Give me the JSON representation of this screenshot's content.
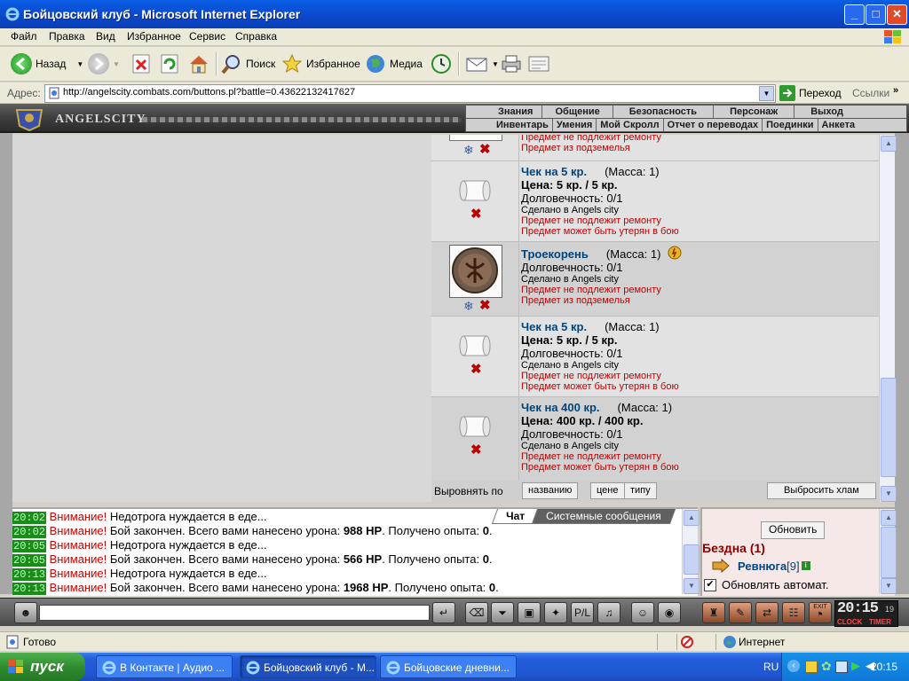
{
  "window": {
    "title": "Бойцовский клуб - Microsoft Internet Explorer",
    "buttons": {
      "minimize": "_",
      "maximize": "□",
      "close": "✕"
    }
  },
  "menu": [
    "Файл",
    "Правка",
    "Вид",
    "Избранное",
    "Сервис",
    "Справка"
  ],
  "toolbar": {
    "back": "Назад",
    "search": "Поиск",
    "favorites": "Избранное",
    "media": "Медиа"
  },
  "address": {
    "label": "Адрес:",
    "url": "http://angelscity.combats.com/buttons.pl?battle=0.43622132417627",
    "go": "Переход",
    "links": "Ссылки"
  },
  "game_header": {
    "logo_text": "ANGELSCITY",
    "nav_top": [
      "Знания",
      "Общение",
      "Безопасность",
      "Персонаж",
      "Выход"
    ],
    "nav_bottom": [
      "Инвентарь",
      "Умения",
      "Мой Скролл",
      "Отчет о переводах",
      "Поединки",
      "Анкета"
    ]
  },
  "items": [
    {
      "partial": true,
      "lines_red": [
        "Предмет не подлежит ремонту",
        "Предмет из подземелья"
      ]
    },
    {
      "name": "Чек на 5 кр.",
      "mass": "(Масса: 1)",
      "price": "Цена: 5 кр. / 5 кр.",
      "durability": "Долговечность: 0/1",
      "made": "Сделано в Angels city",
      "lines_red": [
        "Предмет не подлежит ремонту",
        "Предмет может быть утерян в бою"
      ]
    },
    {
      "name": "Троекорень",
      "mass": "(Масса: 1)",
      "durability": "Долговечность: 0/1",
      "made": "Сделано в Angels city",
      "lines_red": [
        "Предмет не подлежит ремонту",
        "Предмет из подземелья"
      ]
    },
    {
      "name": "Чек на 5 кр.",
      "mass": "(Масса: 1)",
      "price": "Цена: 5 кр. / 5 кр.",
      "durability": "Долговечность: 0/1",
      "made": "Сделано в Angels city",
      "lines_red": [
        "Предмет не подлежит ремонту",
        "Предмет может быть утерян в бою"
      ]
    },
    {
      "name": "Чек на 400 кр.",
      "mass": "(Масса: 1)",
      "price": "Цена: 400 кр. / 400 кр.",
      "durability": "Долговечность: 0/1",
      "made": "Сделано в Angels city",
      "lines_red": [
        "Предмет не подлежит ремонту",
        "Предмет может быть утерян в бою"
      ]
    }
  ],
  "sort": {
    "label": "Выровнять по",
    "by_name": "названию",
    "by_price": "цене",
    "by_type": "типу",
    "drop_junk": "Выбросить хлам"
  },
  "chat": {
    "tabs": [
      "Чат",
      "Системные сообщения"
    ],
    "lines": [
      {
        "time": "20:02",
        "warn": "Внимание!",
        "text": " Недотрога нуждается в еде..."
      },
      {
        "time": "20:02",
        "warn": "Внимание!",
        "text": " Бой закончен. Всего вами нанесено урона: ",
        "hp": "988 HP",
        "text2": ". Получено опыта: ",
        "exp": "0",
        "end": "."
      },
      {
        "time": "20:05",
        "warn": "Внимание!",
        "text": " Недотрога нуждается в еде..."
      },
      {
        "time": "20:05",
        "warn": "Внимание!",
        "text": " Бой закончен. Всего вами нанесено урона: ",
        "hp": "566 HP",
        "text2": ". Получено опыта: ",
        "exp": "0",
        "end": "."
      },
      {
        "time": "20:13",
        "warn": "Внимание!",
        "text": " Недотрога нуждается в еде..."
      },
      {
        "time": "20:13",
        "warn": "Внимание!",
        "text": " Бой закончен. Всего вами нанесено урона: ",
        "hp": "1968 HP",
        "text2": ". Получено опыта: ",
        "exp": "0",
        "end": "."
      }
    ]
  },
  "room": {
    "refresh": "Обновить",
    "name": "Бездна (1)",
    "player": "Ревнюга",
    "level": "[9]",
    "auto_refresh": "Обновлять автомат.",
    "auto_checked": "✔"
  },
  "game_clock": {
    "time": "20:15",
    "seconds": "19",
    "clock_label": "CLOCK",
    "timer_label": "TIMER"
  },
  "gamebar_exit": "EXIT",
  "status": {
    "text": "Готово",
    "zone": "Интернет"
  },
  "taskbar": {
    "start": "пуск",
    "tasks": [
      "В Контакте | Аудио ...",
      "Бойцовский клуб - М...",
      "Бойцовские дневни..."
    ],
    "lang": "RU",
    "time": "20:15"
  },
  "colors": {
    "accent_blue": "#00457e",
    "warning_red": "#c00000",
    "room_red": "#8a0000"
  }
}
